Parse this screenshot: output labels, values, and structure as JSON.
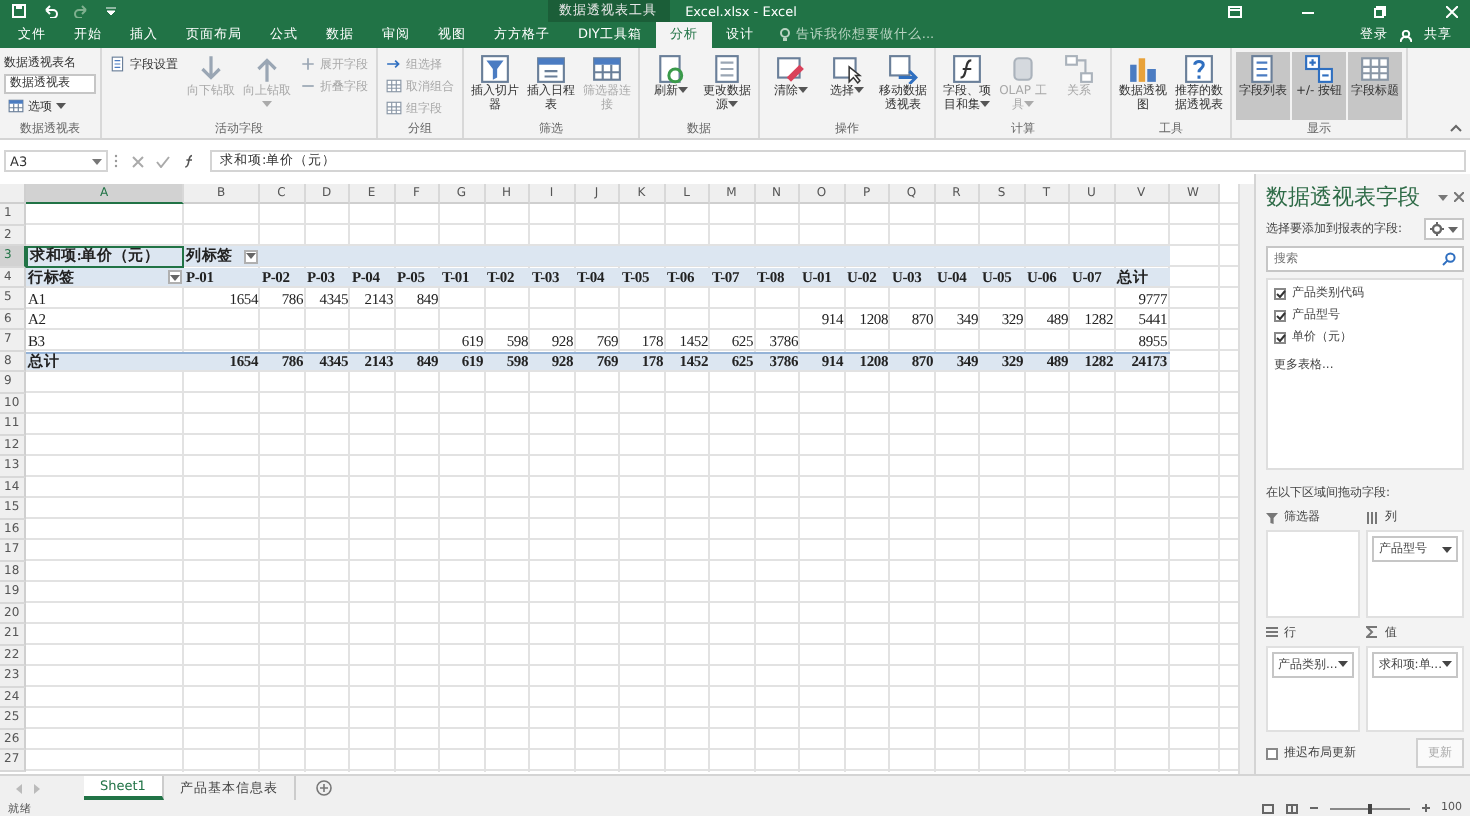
{
  "title_bar": {
    "context_title": "数据透视表工具",
    "title": "Excel.xlsx - Excel"
  },
  "tabs": [
    {
      "label": "文件",
      "selected": false
    },
    {
      "label": "开始",
      "selected": false
    },
    {
      "label": "插入",
      "selected": false
    },
    {
      "label": "页面布局",
      "selected": false
    },
    {
      "label": "公式",
      "selected": false
    },
    {
      "label": "数据",
      "selected": false
    },
    {
      "label": "审阅",
      "selected": false
    },
    {
      "label": "视图",
      "selected": false
    },
    {
      "label": "方方格子",
      "selected": false
    },
    {
      "label": "DIY工具箱",
      "selected": false
    },
    {
      "label": "分析",
      "selected": true
    },
    {
      "label": "设计",
      "selected": false
    }
  ],
  "tell_me": {
    "placeholder": "告诉我你想要做什么..."
  },
  "account": {
    "sign_in": "登录",
    "share": "共享"
  },
  "ribbon_groups": [
    {
      "label": "数据透视表",
      "items": [
        {
          "kind": "caption",
          "label": "数据透视表名"
        },
        {
          "kind": "field",
          "label": "数据透视表"
        },
        {
          "kind": "small",
          "label": "选项",
          "disabled": false,
          "pressed": false,
          "menu": true
        }
      ]
    },
    {
      "label": "活动字段",
      "items": [
        {
          "kind": "small",
          "label": "字段设置",
          "disabled": false,
          "pressed": false,
          "menu": false
        },
        {
          "kind": "large",
          "label": "向下钻取",
          "disabled": true,
          "pressed": false,
          "menu": false
        },
        {
          "kind": "large",
          "label": "向上钻取",
          "disabled": true,
          "pressed": false,
          "menu": true
        },
        {
          "kind": "small",
          "label": "展开字段",
          "disabled": true,
          "pressed": false,
          "menu": false
        },
        {
          "kind": "small",
          "label": "折叠字段",
          "disabled": true,
          "pressed": false,
          "menu": false
        }
      ]
    },
    {
      "label": "分组",
      "items": [
        {
          "kind": "small",
          "label": "组选择",
          "disabled": true,
          "pressed": false,
          "menu": false
        },
        {
          "kind": "small",
          "label": "取消组合",
          "disabled": true,
          "pressed": false,
          "menu": false
        },
        {
          "kind": "small",
          "label": "组字段",
          "disabled": true,
          "pressed": false,
          "menu": false
        }
      ]
    },
    {
      "label": "筛选",
      "items": [
        {
          "kind": "large",
          "label": "插入切片器",
          "disabled": false,
          "pressed": false,
          "menu": false
        },
        {
          "kind": "large",
          "label": "插入日程表",
          "disabled": false,
          "pressed": false,
          "menu": false
        },
        {
          "kind": "large",
          "label": "筛选器连接",
          "disabled": true,
          "pressed": false,
          "menu": false
        }
      ]
    },
    {
      "label": "数据",
      "items": [
        {
          "kind": "large",
          "label": "刷新",
          "disabled": false,
          "pressed": false,
          "menu": true
        },
        {
          "kind": "large",
          "label": "更改数据源",
          "disabled": false,
          "pressed": false,
          "menu": true
        }
      ]
    },
    {
      "label": "操作",
      "items": [
        {
          "kind": "large",
          "label": "清除",
          "disabled": false,
          "pressed": false,
          "menu": true
        },
        {
          "kind": "large",
          "label": "选择",
          "disabled": false,
          "pressed": false,
          "menu": true
        },
        {
          "kind": "large",
          "label": "移动数据透视表",
          "disabled": false,
          "pressed": false,
          "menu": false
        }
      ]
    },
    {
      "label": "计算",
      "items": [
        {
          "kind": "large",
          "label": "字段、项目和集",
          "disabled": false,
          "pressed": false,
          "menu": true
        },
        {
          "kind": "large",
          "label": "OLAP 工具",
          "disabled": true,
          "pressed": false,
          "menu": true
        },
        {
          "kind": "large",
          "label": "关系",
          "disabled": true,
          "pressed": false,
          "menu": false
        }
      ]
    },
    {
      "label": "工具",
      "items": [
        {
          "kind": "large",
          "label": "数据透视图",
          "disabled": false,
          "pressed": false,
          "menu": false
        },
        {
          "kind": "large",
          "label": "推荐的数据透视表",
          "disabled": false,
          "pressed": false,
          "menu": false
        }
      ]
    },
    {
      "label": "显示",
      "items": [
        {
          "kind": "large",
          "label": "字段列表",
          "disabled": false,
          "pressed": true,
          "menu": false
        },
        {
          "kind": "large",
          "label": "+/- 按钮",
          "disabled": false,
          "pressed": true,
          "menu": false
        },
        {
          "kind": "large",
          "label": "字段标题",
          "disabled": false,
          "pressed": true,
          "menu": false
        }
      ]
    }
  ],
  "formula_bar": {
    "name_box": "A3",
    "formula": "求和项:单价（元）"
  },
  "sheet": {
    "columns": [
      {
        "label": "A",
        "selected": true
      },
      {
        "label": "B",
        "selected": false
      },
      {
        "label": "C",
        "selected": false
      },
      {
        "label": "D",
        "selected": false
      },
      {
        "label": "E",
        "selected": false
      },
      {
        "label": "F",
        "selected": false
      },
      {
        "label": "G",
        "selected": false
      },
      {
        "label": "H",
        "selected": false
      },
      {
        "label": "I",
        "selected": false
      },
      {
        "label": "J",
        "selected": false
      },
      {
        "label": "K",
        "selected": false
      },
      {
        "label": "L",
        "selected": false
      },
      {
        "label": "M",
        "selected": false
      },
      {
        "label": "N",
        "selected": false
      },
      {
        "label": "O",
        "selected": false
      },
      {
        "label": "P",
        "selected": false
      },
      {
        "label": "Q",
        "selected": false
      },
      {
        "label": "R",
        "selected": false
      },
      {
        "label": "S",
        "selected": false
      },
      {
        "label": "T",
        "selected": false
      },
      {
        "label": "U",
        "selected": false
      },
      {
        "label": "V",
        "selected": false
      },
      {
        "label": "W",
        "selected": false
      }
    ],
    "rows": [
      {
        "number": "1",
        "selected": false
      },
      {
        "number": "2",
        "selected": false
      },
      {
        "number": "3",
        "selected": true,
        "kind": "pivot_title",
        "cells": [
          "求和项:单价（元）",
          "列标签",
          null,
          null,
          null,
          null,
          null,
          null,
          null,
          null,
          null,
          null,
          null,
          null,
          null,
          null,
          null,
          null,
          null,
          null,
          null,
          null
        ]
      },
      {
        "number": "4",
        "selected": false,
        "kind": "pivot_header",
        "cells": [
          "行标签",
          "P-01",
          "P-02",
          "P-03",
          "P-04",
          "P-05",
          "T-01",
          "T-02",
          "T-03",
          "T-04",
          "T-05",
          "T-06",
          "T-07",
          "T-08",
          "U-01",
          "U-02",
          "U-03",
          "U-04",
          "U-05",
          "U-06",
          "U-07",
          "总计"
        ]
      },
      {
        "number": "5",
        "selected": false,
        "kind": "data",
        "cells": [
          "A1",
          "1654",
          "786",
          "4345",
          "2143",
          "849",
          null,
          null,
          null,
          null,
          null,
          null,
          null,
          null,
          null,
          null,
          null,
          null,
          null,
          null,
          null,
          "9777"
        ]
      },
      {
        "number": "6",
        "selected": false,
        "kind": "data",
        "cells": [
          "A2",
          null,
          null,
          null,
          null,
          null,
          null,
          null,
          null,
          null,
          null,
          null,
          null,
          null,
          "914",
          "1208",
          "870",
          "349",
          "329",
          "489",
          "1282",
          "5441"
        ]
      },
      {
        "number": "7",
        "selected": false,
        "kind": "data",
        "cells": [
          "B3",
          null,
          null,
          null,
          null,
          null,
          "619",
          "598",
          "928",
          "769",
          "178",
          "1452",
          "625",
          "3786",
          null,
          null,
          null,
          null,
          null,
          null,
          null,
          "8955"
        ]
      },
      {
        "number": "8",
        "selected": false,
        "kind": "total",
        "cells": [
          "总计",
          "1654",
          "786",
          "4345",
          "2143",
          "849",
          "619",
          "598",
          "928",
          "769",
          "178",
          "1452",
          "625",
          "3786",
          "914",
          "1208",
          "870",
          "349",
          "329",
          "489",
          "1282",
          "24173"
        ]
      },
      {
        "number": "9",
        "selected": false
      },
      {
        "number": "10",
        "selected": false
      },
      {
        "number": "11",
        "selected": false
      },
      {
        "number": "12",
        "selected": false
      },
      {
        "number": "13",
        "selected": false
      },
      {
        "number": "14",
        "selected": false
      },
      {
        "number": "15",
        "selected": false
      },
      {
        "number": "16",
        "selected": false
      },
      {
        "number": "17",
        "selected": false
      },
      {
        "number": "18",
        "selected": false
      },
      {
        "number": "19",
        "selected": false
      },
      {
        "number": "20",
        "selected": false
      },
      {
        "number": "21",
        "selected": false
      },
      {
        "number": "22",
        "selected": false
      },
      {
        "number": "23",
        "selected": false
      },
      {
        "number": "24",
        "selected": false
      },
      {
        "number": "25",
        "selected": false
      },
      {
        "number": "26",
        "selected": false
      },
      {
        "number": "27",
        "selected": false
      }
    ]
  },
  "field_pane": {
    "title": "数据透视表字段",
    "prompt": "选择要添加到报表的字段:",
    "search": {
      "placeholder": "搜索"
    },
    "fields": [
      {
        "label": "产品类别代码",
        "checked": true
      },
      {
        "label": "产品型号",
        "checked": true
      },
      {
        "label": "单价（元）",
        "checked": true
      }
    ],
    "more_tables": "更多表格...",
    "areas_hint": "在以下区域间拖动字段:",
    "areas": [
      {
        "kind": "filter",
        "label": "筛选器"
      },
      {
        "kind": "columns",
        "label": "列",
        "chips": [
          "产品型号"
        ]
      },
      {
        "kind": "rows",
        "label": "行",
        "chips": [
          "产品类别..."
        ]
      },
      {
        "kind": "values",
        "label": "值",
        "chips": [
          "求和项:单..."
        ]
      }
    ],
    "defer_update": {
      "label": "推迟布局更新",
      "checked": false
    },
    "update_button": {
      "label": "更新",
      "disabled": true
    }
  },
  "sheet_tabs": [
    {
      "label": "Sheet1",
      "selected": true
    },
    {
      "label": "产品基本信息表",
      "selected": false
    }
  ],
  "status_bar": {
    "status": "就绪",
    "zoom_slider": {
      "level": 0.5
    },
    "zoom": "100"
  }
}
